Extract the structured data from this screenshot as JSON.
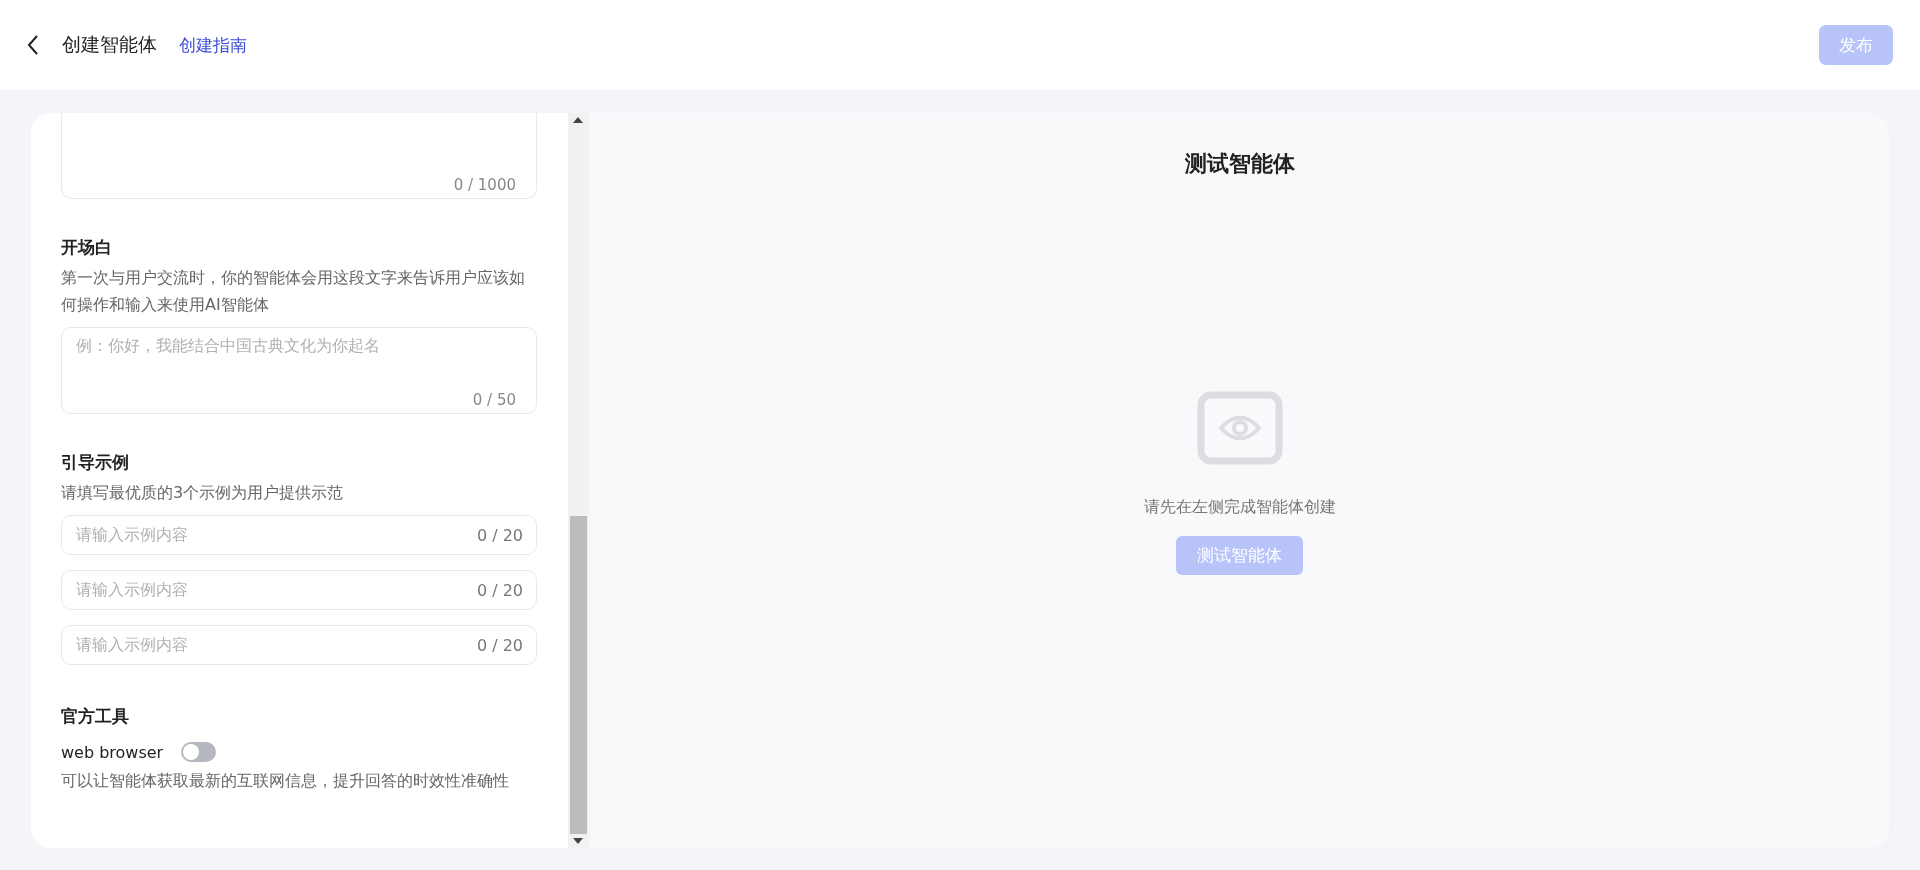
{
  "header": {
    "title": "创建智能体",
    "guide_link": "创建指南",
    "publish_button": {
      "label": "发布",
      "disabled": true
    }
  },
  "form": {
    "description_counter": "0 / 1000",
    "opening": {
      "title": "开场白",
      "hint": "第一次与用户交流时，你的智能体会用这段文字来告诉用户应该如何操作和输入来使用AI智能体",
      "placeholder": "例：你好，我能结合中国古典文化为你起名",
      "counter": "0 / 50"
    },
    "examples": {
      "title": "引导示例",
      "hint": "请填写最优质的3个示例为用户提供示范",
      "fields": [
        {
          "placeholder": "请输入示例内容",
          "counter": "0 / 20"
        },
        {
          "placeholder": "请输入示例内容",
          "counter": "0 / 20"
        },
        {
          "placeholder": "请输入示例内容",
          "counter": "0 / 20"
        }
      ]
    },
    "tools": {
      "title": "官方工具",
      "items": [
        {
          "name": "web browser",
          "on": false,
          "description": "可以让智能体获取最新的互联网信息，提升回答的时效性准确性"
        }
      ]
    }
  },
  "preview": {
    "title": "测试智能体",
    "message": "请先在左侧完成智能体创建",
    "test_button": {
      "label": "测试智能体",
      "disabled": true
    }
  }
}
